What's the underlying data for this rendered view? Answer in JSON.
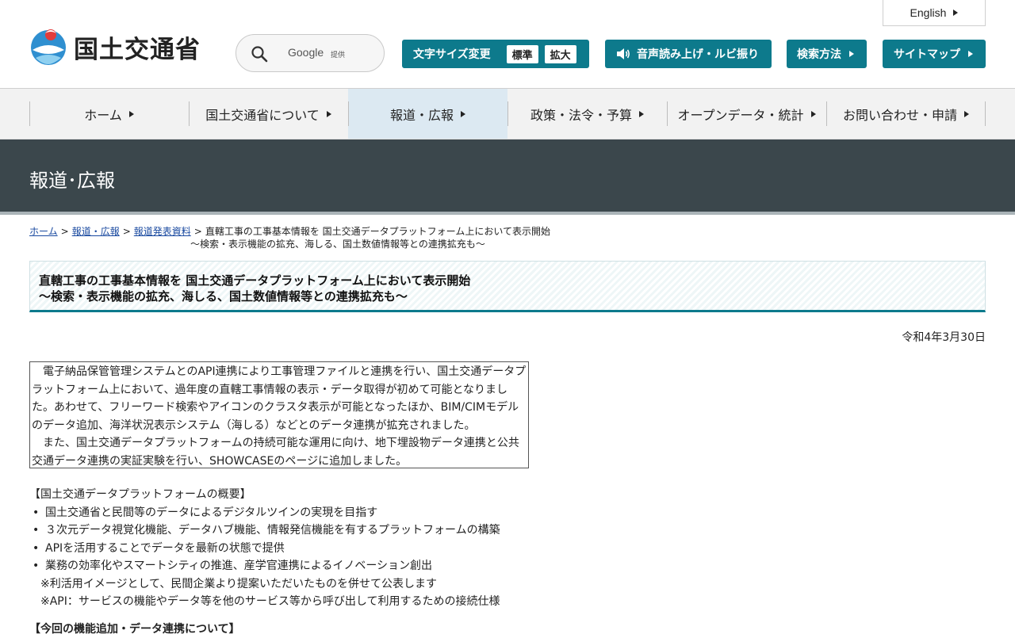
{
  "header": {
    "logo_text": "国土交通省",
    "logo_icon": "mlit-logo-icon",
    "search": {
      "icon": "search-icon",
      "provider": "Google",
      "provided": "提供"
    },
    "english_link": "English",
    "font_size": {
      "label": "文字サイズ変更",
      "standard": "標準",
      "enlarge": "拡大"
    },
    "voice": {
      "icon": "speaker-icon",
      "label": "音声読み上げ・ルビ振り"
    },
    "search_method": "検索方法",
    "sitemap": "サイトマップ",
    "accent_color": "#0d7a8c"
  },
  "nav": {
    "items": [
      {
        "label": "ホーム"
      },
      {
        "label": "国土交通省について"
      },
      {
        "label": "報道・広報"
      },
      {
        "label": "政策・法令・予算"
      },
      {
        "label": "オープンデータ・統計"
      },
      {
        "label": "お問い合わせ・申請"
      }
    ],
    "active": "報道・広報"
  },
  "banner": {
    "title": "報道･広報",
    "color": "#3b474c"
  },
  "breadcrumb": {
    "home": "ホーム",
    "press": "報道・広報",
    "releases": "報道発表資料",
    "current_line1": "直轄工事の工事基本情報を 国土交通データプラットフォーム上において表示開始",
    "current_line2": "～検索・表示機能の拡充、海しる、国土数値情報等との連携拡充も～"
  },
  "article": {
    "title_line1": "直轄工事の工事基本情報を 国土交通データプラットフォーム上において表示開始",
    "title_line2": "～検索・表示機能の拡充、海しる、国土数値情報等との連携拡充も～",
    "date": "令和4年3月30日",
    "lead_p1": "電子納品保管管理システムとのAPI連携により工事管理ファイルと連携を行い、国土交通データプラットフォーム上において、過年度の直轄工事情報の表示・データ取得が初めて可能となりました。あわせて、フリーワード検索やアイコンのクラスタ表示が可能となったほか、BIM/CIMモデルのデータ追加、海洋状況表示システム（海しる）などとのデータ連携が拡充されました。",
    "lead_p2": "また、国土交通データプラットフォームの持続可能な運用に向け、地下埋設物データ連携と公共交通データ連携の実証実験を行い、SHOWCASEのページに追加しました。",
    "overview_heading": "【国土交通データプラットフォームの概要】",
    "overview_items": [
      "国土交通省と民間等のデータによるデジタルツインの実現を目指す",
      "３次元データ視覚化機能、データハブ機能、情報発信機能を有するプラットフォームの構築",
      "APIを活用することでデータを最新の状態で提供",
      "業務の効率化やスマートシティの推進、産学官連携によるイノベーション創出"
    ],
    "note1": "※利活用イメージとして、民間企業より提案いただいたものを併せて公表します",
    "note2": "※API：サービスの機能やデータ等を他のサービス等から呼び出して利用するための接続仕様",
    "cutoff_heading": "【今回の機能追加・データ連携について】"
  }
}
